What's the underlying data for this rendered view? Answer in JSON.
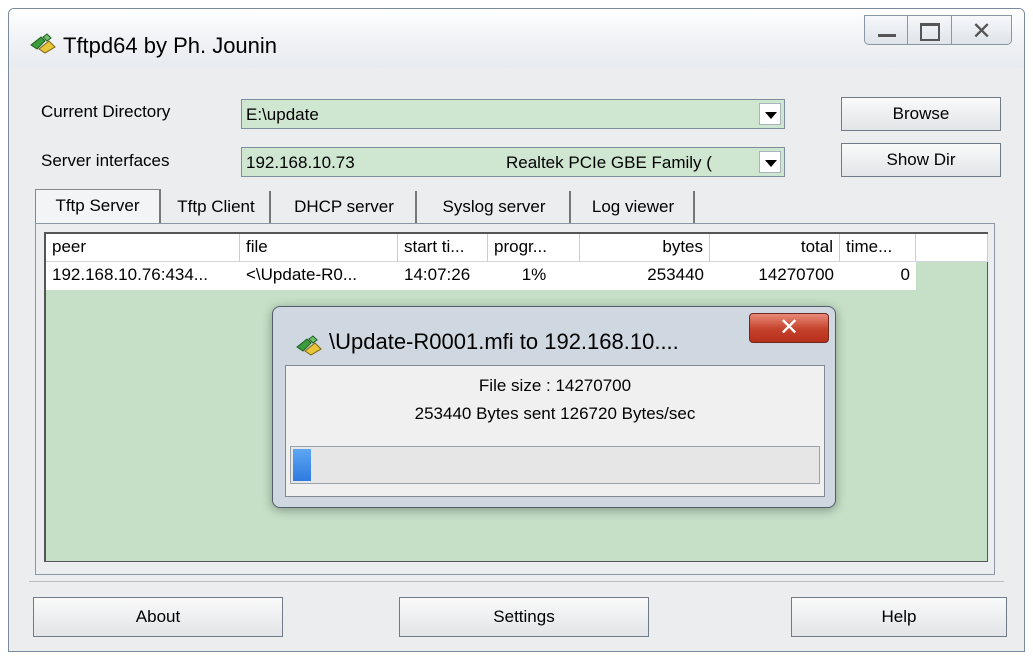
{
  "window": {
    "title": "Tftpd64 by Ph. Jounin",
    "controls": {
      "minimize": "minimize",
      "maximize": "maximize",
      "close": "close"
    }
  },
  "form": {
    "current_directory_label": "Current Directory",
    "current_directory_value": "E:\\update",
    "server_interfaces_label": "Server interfaces",
    "server_interfaces_ip": "192.168.10.73",
    "server_interfaces_adapter": "Realtek PCIe GBE Family (",
    "browse_label": "Browse",
    "show_dir_label": "Show Dir"
  },
  "tabs": [
    {
      "label": "Tftp Server",
      "active": true
    },
    {
      "label": "Tftp Client",
      "active": false
    },
    {
      "label": "DHCP server",
      "active": false
    },
    {
      "label": "Syslog server",
      "active": false
    },
    {
      "label": "Log viewer",
      "active": false
    }
  ],
  "table": {
    "columns": [
      "peer",
      "file",
      "start ti...",
      "progr...",
      "bytes",
      "total",
      "time..."
    ],
    "rows": [
      [
        "192.168.10.76:434...",
        "<\\Update-R0...",
        "14:07:26",
        "1%",
        "253440",
        "14270700",
        "0"
      ]
    ]
  },
  "dialog": {
    "title": "\\Update-R0001.mfi to 192.168.10....",
    "file_size_line": "File size : 14270700",
    "status_line": "253440 Bytes sent  126720 Bytes/sec",
    "progress_fraction": 0.018
  },
  "footer": {
    "about_label": "About",
    "settings_label": "Settings",
    "help_label": "Help"
  },
  "colors": {
    "list_background": "#c5e0c7",
    "combo_background": "#cfe6d0",
    "progress_fill": "#2d7be0",
    "dialog_close": "#c4412a"
  },
  "icons": [
    "tftpd-app-icon",
    "dialog-app-icon",
    "dropdown-arrow-icon"
  ]
}
